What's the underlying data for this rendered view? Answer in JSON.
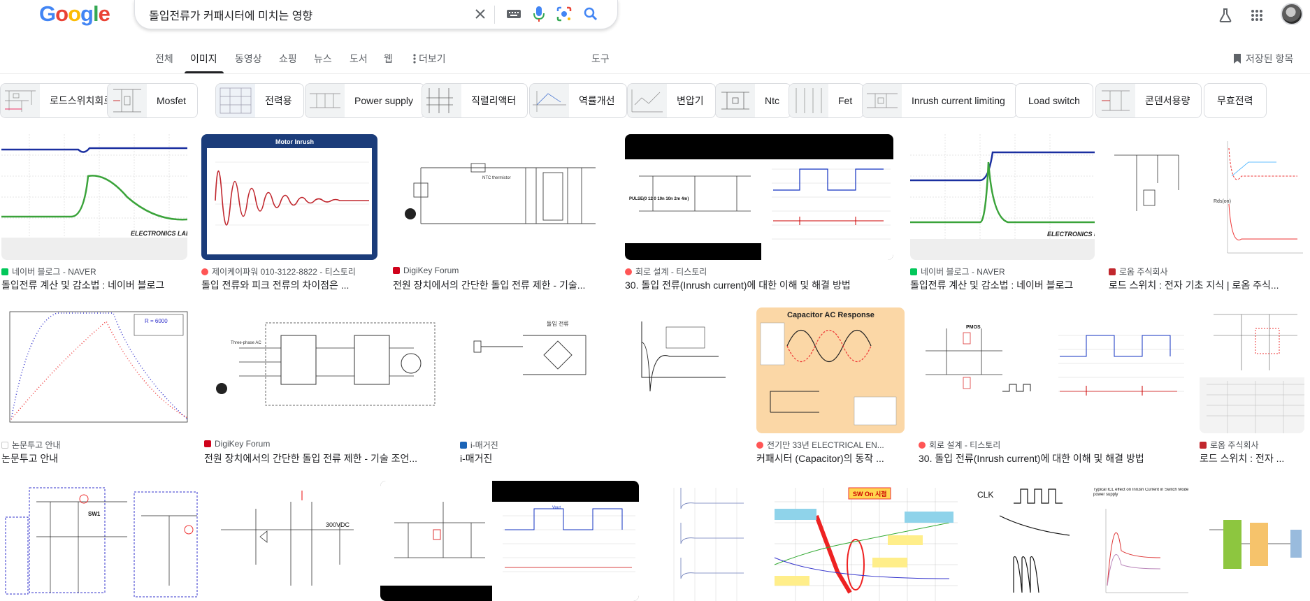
{
  "colors": {
    "google_blue": "#4285F4",
    "google_red": "#EA4335",
    "google_yellow": "#FBBC05",
    "google_green": "#34A853",
    "text_secondary": "#5f6368"
  },
  "header": {
    "logo_letters": [
      "G",
      "o",
      "o",
      "g",
      "l",
      "e"
    ],
    "search_query": "돌입전류가 커패시터에 미치는 영향",
    "icons": [
      "clear-icon",
      "keyboard-icon",
      "microphone-icon",
      "lens-icon",
      "search-icon",
      "labs-icon",
      "apps-icon"
    ]
  },
  "tabs": {
    "items": [
      "전체",
      "이미지",
      "동영상",
      "쇼핑",
      "뉴스",
      "도서",
      "웹",
      "더보기"
    ],
    "active": "이미지",
    "tools": "도구",
    "saved": "저장된 항목"
  },
  "chips": [
    "로드스위치회로",
    "Mosfet",
    "전력용",
    "Power supply",
    "직렬리액터",
    "역률개선",
    "변압기",
    "Ntc",
    "Fet",
    "Inrush current limiting",
    "Load switch",
    "콘덴서용량",
    "무효전력"
  ],
  "results": [
    {
      "source": "네이버 블로그 - NAVER",
      "title": "돌입전류 계산 및 감소법 : 네이버 블로그",
      "img_text": "ELECTRONICS LABORATORY"
    },
    {
      "source": "제이케이파워 010-3122-8822 - 티스토리",
      "title": "돌입 전류와 피크 전류의 차이점은 ...",
      "img_text": "Motor Inrush"
    },
    {
      "source": "DigiKey Forum",
      "title": "전원 장치에서의 간단한 돌입 전류 제한 - 기술...",
      "img_text": "NTC thermistor"
    },
    {
      "source": "회로 설계 - 티스토리",
      "title": "30. 돌입 전류(Inrush current)에 대한 이해 및 해결 방법",
      "img_text": "PULSE(0 12 0 10n 10n 2m 4m)"
    },
    {
      "source": "네이버 블로그 - NAVER",
      "title": "돌입전류 계산 및 감소법 : 네이버 블로그",
      "img_text": "ELECTRONICS LABORATORY"
    },
    {
      "source": "로옴 주식회사",
      "title": "로드 스위치 : 전자 기초 지식 | 로옴 주식...",
      "img_text": "Rds(on)"
    },
    {
      "source": "논문투고 안내",
      "title": "논문투고 안내",
      "img_text": "R = 6000"
    },
    {
      "source": "DigiKey Forum",
      "title": "전원 장치에서의 간단한 돌입 전류 제한 - 기술 조언...",
      "img_text": "Three-phase AC"
    },
    {
      "source": "i-매거진",
      "title": "i-매거진",
      "img_text": "돌입 전류"
    },
    {
      "source": "전기만 33년 ELECTRICAL EN...",
      "title": "커패시터 (Capacitor)의 동작 ...",
      "img_text": "Capacitor AC Response"
    },
    {
      "source": "회로 설계 - 티스토리",
      "title": "30. 돌입 전류(Inrush current)에 대한 이해 및 해결 방법",
      "img_text": "PMOS"
    },
    {
      "source": "로옴 주식회사",
      "title": "로드 스위치 : 전자 ...",
      "img_text": ""
    },
    {
      "source": "",
      "title": "",
      "img_text": "SW1"
    },
    {
      "source": "",
      "title": "",
      "img_text": "300VDC"
    },
    {
      "source": "",
      "title": "",
      "img_text": "Vout"
    },
    {
      "source": "",
      "title": "",
      "img_text": ""
    },
    {
      "source": "",
      "title": "",
      "img_text": "SW On 시점"
    },
    {
      "source": "",
      "title": "",
      "img_text": "CLK"
    },
    {
      "source": "",
      "title": "",
      "img_text": "Typical ICL effect on Inrush Current in Switch Mode power supply"
    }
  ]
}
